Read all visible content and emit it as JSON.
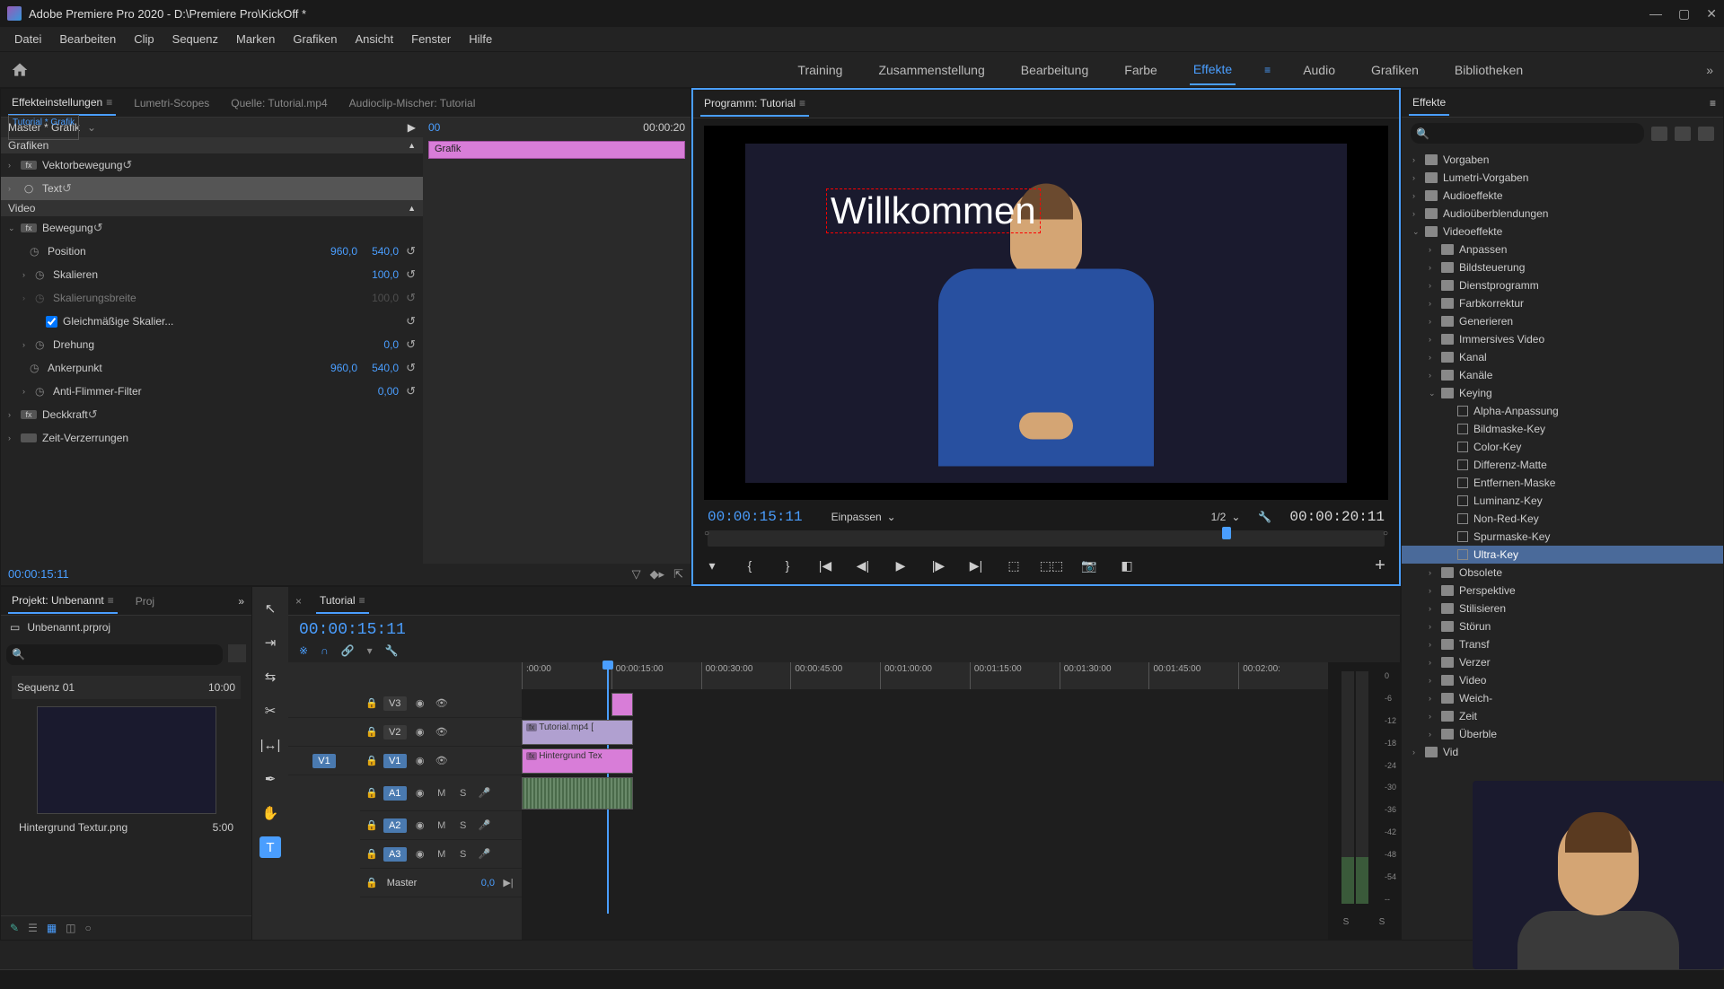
{
  "app": {
    "title": "Adobe Premiere Pro 2020 - D:\\Premiere Pro\\KickOff *"
  },
  "menu": [
    "Datei",
    "Bearbeiten",
    "Clip",
    "Sequenz",
    "Marken",
    "Grafiken",
    "Ansicht",
    "Fenster",
    "Hilfe"
  ],
  "workspaces": [
    "Training",
    "Zusammenstellung",
    "Bearbeitung",
    "Farbe",
    "Effekte",
    "Audio",
    "Grafiken",
    "Bibliotheken"
  ],
  "workspace_active": "Effekte",
  "ec_tabs": [
    "Effekteinstellungen",
    "Lumetri-Scopes",
    "Quelle: Tutorial.mp4",
    "Audioclip-Mischer: Tutorial"
  ],
  "ec": {
    "master": "Master * Grafik",
    "clip": "Tutorial * Grafik",
    "right_time": "00:00:20",
    "right_playhead": "00",
    "right_clip": "Grafik",
    "section_grafiken": "Grafiken",
    "vektorbewegung": "Vektorbewegung",
    "text": "Text",
    "section_video": "Video",
    "bewegung": "Bewegung",
    "position": "Position",
    "position_x": "960,0",
    "position_y": "540,0",
    "skalieren": "Skalieren",
    "skalieren_v": "100,0",
    "skalierungsbreite": "Skalierungsbreite",
    "skal_b_v": "100,0",
    "gleich": "Gleichmäßige Skalier...",
    "drehung": "Drehung",
    "drehung_v": "0,0",
    "ankerpunkt": "Ankerpunkt",
    "ankerpunkt_x": "960,0",
    "ankerpunkt_y": "540,0",
    "antiflimmer": "Anti-Flimmer-Filter",
    "antiflimmer_v": "0,00",
    "deckkraft": "Deckkraft",
    "zeit": "Zeit-Verzerrungen",
    "timecode": "00:00:15:11"
  },
  "program": {
    "tab": "Programm: Tutorial",
    "title_text": "Willkommen",
    "tc": "00:00:15:11",
    "fit": "Einpassen",
    "zoom": "1/2",
    "dur": "00:00:20:11"
  },
  "effects": {
    "tab": "Effekte",
    "tree": [
      {
        "l": 1,
        "exp": "›",
        "t": "folder",
        "label": "Vorgaben"
      },
      {
        "l": 1,
        "exp": "›",
        "t": "folder",
        "label": "Lumetri-Vorgaben"
      },
      {
        "l": 1,
        "exp": "›",
        "t": "folder",
        "label": "Audioeffekte"
      },
      {
        "l": 1,
        "exp": "›",
        "t": "folder",
        "label": "Audioüberblendungen"
      },
      {
        "l": 1,
        "exp": "⌄",
        "t": "folder",
        "label": "Videoeffekte"
      },
      {
        "l": 2,
        "exp": "›",
        "t": "folder",
        "label": "Anpassen"
      },
      {
        "l": 2,
        "exp": "›",
        "t": "folder",
        "label": "Bildsteuerung"
      },
      {
        "l": 2,
        "exp": "›",
        "t": "folder",
        "label": "Dienstprogramm"
      },
      {
        "l": 2,
        "exp": "›",
        "t": "folder",
        "label": "Farbkorrektur"
      },
      {
        "l": 2,
        "exp": "›",
        "t": "folder",
        "label": "Generieren"
      },
      {
        "l": 2,
        "exp": "›",
        "t": "folder",
        "label": "Immersives Video"
      },
      {
        "l": 2,
        "exp": "›",
        "t": "folder",
        "label": "Kanal"
      },
      {
        "l": 2,
        "exp": "›",
        "t": "folder",
        "label": "Kanäle"
      },
      {
        "l": 2,
        "exp": "⌄",
        "t": "folder",
        "label": "Keying"
      },
      {
        "l": 3,
        "exp": "",
        "t": "preset",
        "label": "Alpha-Anpassung"
      },
      {
        "l": 3,
        "exp": "",
        "t": "preset",
        "label": "Bildmaske-Key"
      },
      {
        "l": 3,
        "exp": "",
        "t": "preset",
        "label": "Color-Key"
      },
      {
        "l": 3,
        "exp": "",
        "t": "preset",
        "label": "Differenz-Matte"
      },
      {
        "l": 3,
        "exp": "",
        "t": "preset",
        "label": "Entfernen-Maske"
      },
      {
        "l": 3,
        "exp": "",
        "t": "preset",
        "label": "Luminanz-Key"
      },
      {
        "l": 3,
        "exp": "",
        "t": "preset",
        "label": "Non-Red-Key"
      },
      {
        "l": 3,
        "exp": "",
        "t": "preset",
        "label": "Spurmaske-Key"
      },
      {
        "l": 3,
        "exp": "",
        "t": "preset",
        "label": "Ultra-Key",
        "selected": true
      },
      {
        "l": 2,
        "exp": "›",
        "t": "folder",
        "label": "Obsolete"
      },
      {
        "l": 2,
        "exp": "›",
        "t": "folder",
        "label": "Perspektive"
      },
      {
        "l": 2,
        "exp": "›",
        "t": "folder",
        "label": "Stilisieren"
      },
      {
        "l": 2,
        "exp": "›",
        "t": "folder",
        "label": "Störun"
      },
      {
        "l": 2,
        "exp": "›",
        "t": "folder",
        "label": "Transf"
      },
      {
        "l": 2,
        "exp": "›",
        "t": "folder",
        "label": "Verzer"
      },
      {
        "l": 2,
        "exp": "›",
        "t": "folder",
        "label": "Video"
      },
      {
        "l": 2,
        "exp": "›",
        "t": "folder",
        "label": "Weich-"
      },
      {
        "l": 2,
        "exp": "›",
        "t": "folder",
        "label": "Zeit"
      },
      {
        "l": 2,
        "exp": "›",
        "t": "folder",
        "label": "Überble"
      },
      {
        "l": 1,
        "exp": "›",
        "t": "folder",
        "label": "Vid"
      }
    ]
  },
  "project": {
    "tab": "Projekt: Unbenannt",
    "tab2": "Proj",
    "file": "Unbenannt.prproj",
    "seq": "Sequenz 01",
    "seq_dur": "10:00",
    "asset": "Hintergrund Textur.png",
    "asset_dur": "5:00"
  },
  "timeline": {
    "tab": "Tutorial",
    "tc": "00:00:15:11",
    "ruler": [
      ":00:00",
      "00:00:15:00",
      "00:00:30:00",
      "00:00:45:00",
      "00:01:00:00",
      "00:01:15:00",
      "00:01:30:00",
      "00:01:45:00",
      "00:02:00:"
    ],
    "tracks_v": [
      "V3",
      "V2",
      "V1"
    ],
    "tracks_a": [
      "A1",
      "A2",
      "A3"
    ],
    "master": "Master",
    "master_v": "0,0",
    "clip_v2": "Tutorial.mp4 [",
    "clip_v1": "Hintergrund Tex",
    "src_v1": "V1"
  },
  "meters": [
    "0",
    "-6",
    "-12",
    "-18",
    "-24",
    "-30",
    "-36",
    "-42",
    "-48",
    "-54",
    "--"
  ],
  "meter_s": "S"
}
